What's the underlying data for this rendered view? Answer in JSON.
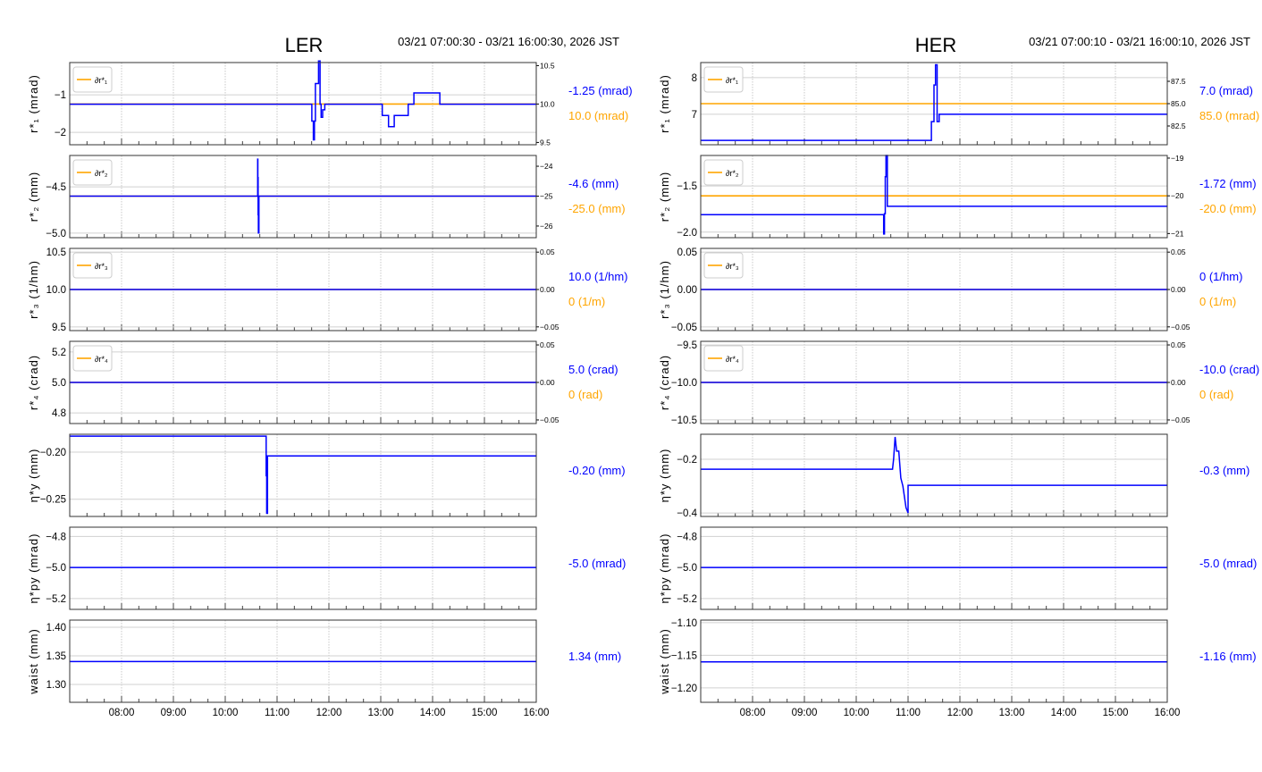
{
  "chart_data": [
    {
      "type": "line",
      "title": "LER",
      "time_range": "03/21 07:00:30 - 03/21 16:00:30, 2026 JST",
      "xlim": [
        7.0,
        16.0
      ],
      "xticks": [
        "08:00",
        "09:00",
        "10:00",
        "11:00",
        "12:00",
        "13:00",
        "14:00",
        "15:00",
        "16:00"
      ],
      "panels": [
        {
          "ylabel": "r*₁ (mrad)",
          "ylim": [
            -2.33,
            -0.14
          ],
          "yticks": [
            -1,
            -2
          ],
          "ytick_labels": [
            "−1",
            "−2"
          ],
          "right": {
            "ylim": [
              9.47,
              10.54
            ],
            "yticks": [
              10.5,
              10.0,
              9.5
            ],
            "ytick_labels": [
              "10.5",
              "10.0",
              "9.5"
            ]
          },
          "ref_value": 10.0,
          "legend": "∂r*₁",
          "value_label": "-1.25 (mrad)",
          "ref_label": "10.0 (mrad)",
          "series": [
            [
              7.0,
              -1.25
            ],
            [
              11.67,
              -1.7
            ],
            [
              11.7,
              -2.2
            ],
            [
              11.72,
              -1.7
            ],
            [
              11.74,
              -0.7
            ],
            [
              11.8,
              -0.1
            ],
            [
              11.83,
              -1.25
            ],
            [
              11.85,
              -1.6
            ],
            [
              11.88,
              -1.4
            ],
            [
              11.92,
              -1.25
            ],
            [
              13.03,
              -1.55
            ],
            [
              13.15,
              -1.85
            ],
            [
              13.26,
              -1.55
            ],
            [
              13.53,
              -1.25
            ],
            [
              13.64,
              -0.95
            ],
            [
              14.14,
              -1.25
            ],
            [
              16.0,
              -1.25
            ]
          ]
        },
        {
          "ylabel": "r*₂ (mm)",
          "ylim": [
            -5.05,
            -4.16
          ],
          "yticks": [
            -4.5,
            -5.0
          ],
          "ytick_labels": [
            "−4.5",
            "−5.0"
          ],
          "right": {
            "ylim": [
              -26.39,
              -23.64
            ],
            "yticks": [
              -24,
              -25,
              -26
            ],
            "ytick_labels": [
              "−24",
              "−25",
              "−26"
            ]
          },
          "ref_value": -25.0,
          "legend": "∂r*₂",
          "value_label": "-4.6 (mm)",
          "ref_label": "-25.0 (mm)",
          "series": [
            [
              7.0,
              -4.6
            ],
            [
              10.62,
              -4.6
            ],
            [
              10.625,
              -4.2
            ],
            [
              10.63,
              -4.4
            ],
            [
              10.635,
              -4.8
            ],
            [
              10.64,
              -5.0
            ],
            [
              10.65,
              -4.6
            ],
            [
              16.0,
              -4.6
            ]
          ]
        },
        {
          "ylabel": "r*₃ (1/hm)",
          "ylim": [
            9.45,
            10.55
          ],
          "yticks": [
            10.5,
            10.0,
            9.5
          ],
          "ytick_labels": [
            "10.5",
            "10.0",
            "9.5"
          ],
          "right": {
            "ylim": [
              -0.055,
              0.055
            ],
            "yticks": [
              0.05,
              0,
              -0.05
            ],
            "ytick_labels": [
              "0.05",
              "0.00",
              "−0.05"
            ]
          },
          "ref_value": 0,
          "legend": "∂r*₃",
          "value_label": "10.0 (1/hm)",
          "ref_label": "0 (1/m)",
          "series": [
            [
              7.0,
              10.0
            ],
            [
              16.0,
              10.0
            ]
          ]
        },
        {
          "ylabel": "r*₄ (crad)",
          "ylim": [
            4.73,
            5.27
          ],
          "yticks": [
            5.2,
            5.0,
            4.8
          ],
          "ytick_labels": [
            "5.2",
            "5.0",
            "4.8"
          ],
          "right": {
            "ylim": [
              -0.0548,
              0.0548
            ],
            "yticks": [
              0.05,
              0,
              -0.05
            ],
            "ytick_labels": [
              "0.05",
              "0.00",
              "−0.05"
            ]
          },
          "ref_value": 0,
          "legend": "∂r*₄",
          "value_label": "5.0 (crad)",
          "ref_label": "0 (rad)",
          "series": [
            [
              7.0,
              5.0
            ],
            [
              16.0,
              5.0
            ]
          ]
        },
        {
          "ylabel": "η*y (mm)",
          "ylim": [
            -0.2683,
            -0.181
          ],
          "yticks": [
            -0.2,
            -0.25
          ],
          "ytick_labels": [
            "−0.20",
            "−0.25"
          ],
          "value_label": "-0.20 (mm)",
          "series": [
            [
              7.0,
              -0.183
            ],
            [
              10.79,
              -0.225
            ],
            [
              10.8,
              -0.265
            ],
            [
              10.815,
              -0.204
            ],
            [
              16.0,
              -0.204
            ]
          ]
        },
        {
          "ylabel": "η*py (mrad)",
          "ylim": [
            -5.27,
            -4.74
          ],
          "yticks": [
            -4.8,
            -5.0,
            -5.2
          ],
          "ytick_labels": [
            "−4.8",
            "−5.0",
            "−5.2"
          ],
          "value_label": "-5.0 (mrad)",
          "series": [
            [
              7.0,
              -5.0
            ],
            [
              16.0,
              -5.0
            ]
          ]
        },
        {
          "ylabel": "waist (mm)",
          "ylim": [
            1.2687,
            1.4125
          ],
          "yticks": [
            1.4,
            1.35,
            1.3
          ],
          "ytick_labels": [
            "1.40",
            "1.35",
            "1.30"
          ],
          "value_label": "1.34 (mm)",
          "series": [
            [
              7.0,
              1.34
            ],
            [
              16.0,
              1.34
            ]
          ]
        }
      ]
    },
    {
      "type": "line",
      "title": "HER",
      "time_range": "03/21 07:00:10 - 03/21 16:00:10, 2026 JST",
      "xlim": [
        7.0,
        16.0
      ],
      "xticks": [
        "08:00",
        "09:00",
        "10:00",
        "11:00",
        "12:00",
        "13:00",
        "14:00",
        "15:00",
        "16:00"
      ],
      "panels": [
        {
          "ylabel": "r*₁ (mrad)",
          "ylim": [
            6.17,
            8.41
          ],
          "yticks": [
            8,
            7
          ],
          "ytick_labels": [
            "8",
            "7"
          ],
          "right": {
            "ylim": [
              80.4,
              89.6
            ],
            "yticks": [
              87.5,
              85.0,
              82.5
            ],
            "ytick_labels": [
              "87.5",
              "85.0",
              "82.5"
            ]
          },
          "ref_value": 85.0,
          "legend": "∂r*₁",
          "value_label": "7.0 (mrad)",
          "ref_label": "85.0 (mrad)",
          "series": [
            [
              7.0,
              6.29
            ],
            [
              11.45,
              6.8
            ],
            [
              11.5,
              7.8
            ],
            [
              11.53,
              8.35
            ],
            [
              11.56,
              6.8
            ],
            [
              11.6,
              7.0
            ],
            [
              16.0,
              7.0
            ]
          ]
        },
        {
          "ylabel": "r*₂ (mm)",
          "ylim": [
            -2.06,
            -1.17
          ],
          "yticks": [
            -1.5,
            -2.0
          ],
          "ytick_labels": [
            "−1.5",
            "−2.0"
          ],
          "right": {
            "ylim": [
              -21.11,
              -18.93
            ],
            "yticks": [
              -19,
              -20,
              -21
            ],
            "ytick_labels": [
              "−19",
              "−20",
              "−21"
            ]
          },
          "ref_value": -20.0,
          "legend": "∂r*₂",
          "value_label": "-1.72 (mm)",
          "ref_label": "-20.0 (mm)",
          "series": [
            [
              7.0,
              -1.81
            ],
            [
              10.53,
              -2.02
            ],
            [
              10.545,
              -1.8
            ],
            [
              10.56,
              -1.4
            ],
            [
              10.575,
              -1.17
            ],
            [
              10.6,
              -1.72
            ],
            [
              16.0,
              -1.72
            ]
          ]
        },
        {
          "ylabel": "r*₃ (1/hm)",
          "ylim": [
            -0.055,
            0.055
          ],
          "yticks": [
            0.05,
            0,
            -0.05
          ],
          "ytick_labels": [
            "0.05",
            "0.00",
            "−0.05"
          ],
          "right": {
            "ylim": [
              -0.055,
              0.055
            ],
            "yticks": [
              0.05,
              0,
              -0.05
            ],
            "ytick_labels": [
              "0.05",
              "0.00",
              "−0.05"
            ]
          },
          "ref_value": 0,
          "legend": "∂r*₃",
          "value_label": "0 (1/hm)",
          "ref_label": "0 (1/m)",
          "series": [
            [
              7.0,
              0
            ],
            [
              16.0,
              0
            ]
          ]
        },
        {
          "ylabel": "r*₄ (crad)",
          "ylim": [
            -10.55,
            -9.45
          ],
          "yticks": [
            -9.5,
            -10.0,
            -10.5
          ],
          "ytick_labels": [
            "−9.5",
            "−10.0",
            "−10.5"
          ],
          "right": {
            "ylim": [
              -0.0548,
              0.0548
            ],
            "yticks": [
              0.05,
              0,
              -0.05
            ],
            "ytick_labels": [
              "0.05",
              "0.00",
              "−0.05"
            ]
          },
          "ref_value": 0,
          "legend": "∂r*₄",
          "value_label": "-10.0 (crad)",
          "ref_label": "0 (rad)",
          "series": [
            [
              7.0,
              -10.0
            ],
            [
              16.0,
              -10.0
            ]
          ]
        },
        {
          "ylabel": "η*y (mm)",
          "ylim": [
            -0.413,
            -0.107
          ],
          "yticks": [
            -0.2,
            -0.4
          ],
          "ytick_labels": [
            "−0.2",
            "−0.4"
          ],
          "value_label": "-0.3 (mm)",
          "linear": true,
          "series": [
            [
              7.0,
              -0.237
            ],
            [
              10.7,
              -0.237
            ],
            [
              10.72,
              -0.2
            ],
            [
              10.75,
              -0.117
            ],
            [
              10.78,
              -0.17
            ],
            [
              10.82,
              -0.17
            ],
            [
              10.86,
              -0.27
            ],
            [
              10.9,
              -0.3
            ],
            [
              10.96,
              -0.38
            ],
            [
              11.0,
              -0.4
            ],
            [
              11.0,
              -0.297
            ],
            [
              16.0,
              -0.297
            ]
          ]
        },
        {
          "ylabel": "η*py (mrad)",
          "ylim": [
            -5.27,
            -4.74
          ],
          "yticks": [
            -4.8,
            -5.0,
            -5.2
          ],
          "ytick_labels": [
            "−4.8",
            "−5.0",
            "−5.2"
          ],
          "value_label": "-5.0 (mrad)",
          "series": [
            [
              7.0,
              -5.0
            ],
            [
              16.0,
              -5.0
            ]
          ]
        },
        {
          "ylabel": "waist (mm)",
          "ylim": [
            -1.222,
            -1.096
          ],
          "yticks": [
            -1.1,
            -1.15,
            -1.2
          ],
          "ytick_labels": [
            "−1.10",
            "−1.15",
            "−1.20"
          ],
          "value_label": "-1.16 (mm)",
          "series": [
            [
              7.0,
              -1.16
            ],
            [
              16.0,
              -1.16
            ]
          ]
        }
      ]
    }
  ],
  "colors": {
    "measured": "#0000ff",
    "reference": "#ffa500",
    "grid": "#cccccc"
  }
}
